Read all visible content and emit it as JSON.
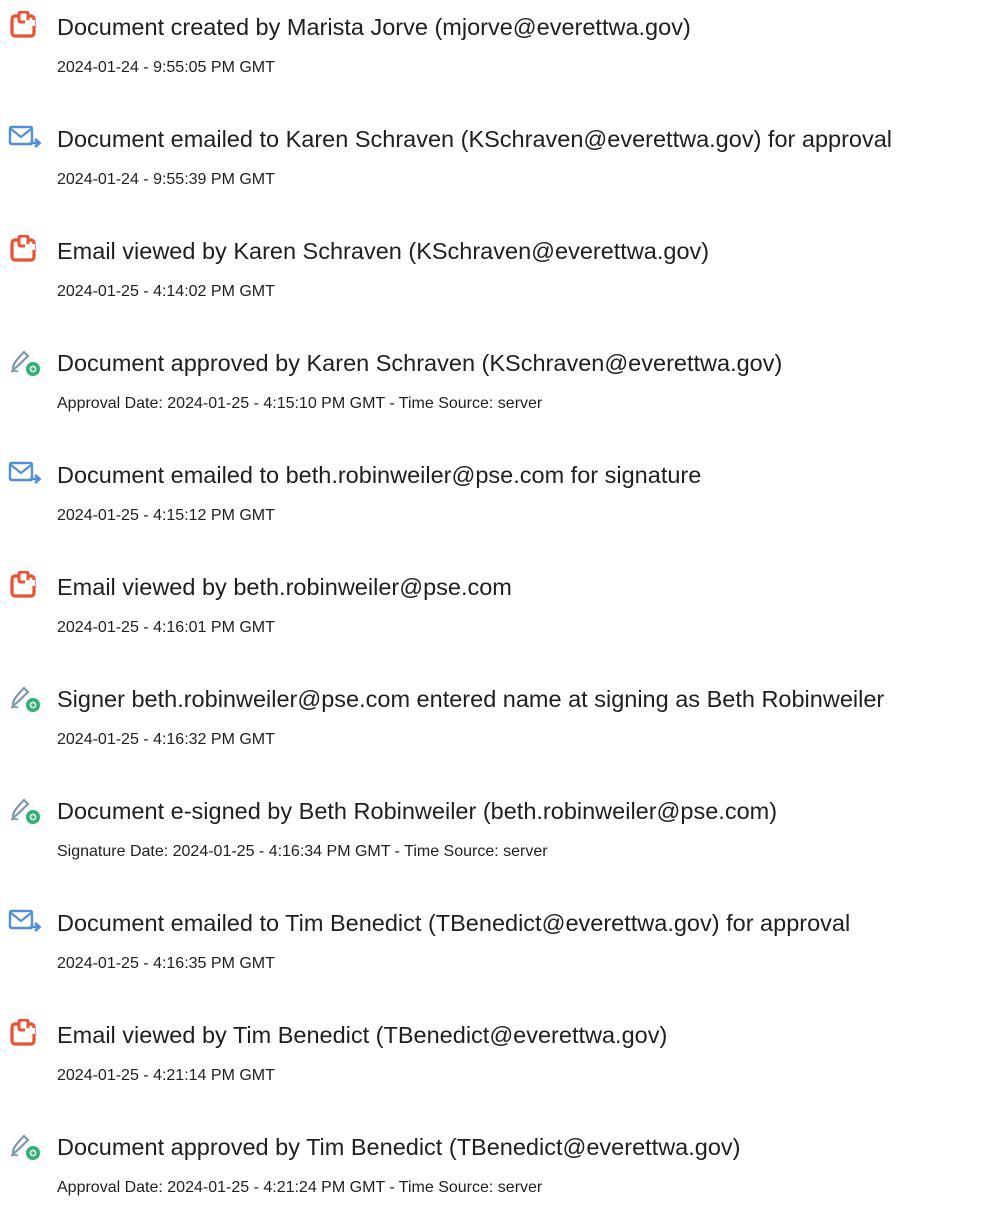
{
  "colors": {
    "doc_icon": "#e8532e",
    "email_icon": "#4f8fd8",
    "pen_icon": "#7c9aa8",
    "pen_badge": "#2db36b"
  },
  "entries": [
    {
      "icon": "document-icon",
      "title": "Document created by Marista Jorve (mjorve@everettwa.gov)",
      "detail": "2024-01-24 - 9:55:05 PM GMT"
    },
    {
      "icon": "email-icon",
      "title": "Document emailed to Karen Schraven (KSchraven@everettwa.gov) for approval",
      "detail": "2024-01-24 - 9:55:39 PM GMT"
    },
    {
      "icon": "document-icon",
      "title": "Email viewed by Karen Schraven (KSchraven@everettwa.gov)",
      "detail": "2024-01-25 - 4:14:02 PM GMT"
    },
    {
      "icon": "sign-pen-icon",
      "title": "Document approved by Karen Schraven (KSchraven@everettwa.gov)",
      "detail": "Approval Date: 2024-01-25 - 4:15:10 PM GMT - Time Source: server"
    },
    {
      "icon": "email-icon",
      "title": "Document emailed to beth.robinweiler@pse.com for signature",
      "detail": "2024-01-25 - 4:15:12 PM GMT"
    },
    {
      "icon": "document-icon",
      "title": "Email viewed by beth.robinweiler@pse.com",
      "detail": "2024-01-25 - 4:16:01 PM GMT"
    },
    {
      "icon": "sign-pen-icon",
      "title": "Signer beth.robinweiler@pse.com entered name at signing as Beth Robinweiler",
      "detail": "2024-01-25 - 4:16:32 PM GMT"
    },
    {
      "icon": "sign-pen-icon",
      "title": "Document e-signed by Beth Robinweiler (beth.robinweiler@pse.com)",
      "detail": "Signature Date: 2024-01-25 - 4:16:34 PM GMT - Time Source: server"
    },
    {
      "icon": "email-icon",
      "title": "Document emailed to Tim Benedict (TBenedict@everettwa.gov) for approval",
      "detail": "2024-01-25 - 4:16:35 PM GMT"
    },
    {
      "icon": "document-icon",
      "title": "Email viewed by Tim Benedict (TBenedict@everettwa.gov)",
      "detail": "2024-01-25 - 4:21:14 PM GMT"
    },
    {
      "icon": "sign-pen-icon",
      "title": "Document approved by Tim Benedict (TBenedict@everettwa.gov)",
      "detail": "Approval Date: 2024-01-25 - 4:21:24 PM GMT - Time Source: server"
    }
  ]
}
